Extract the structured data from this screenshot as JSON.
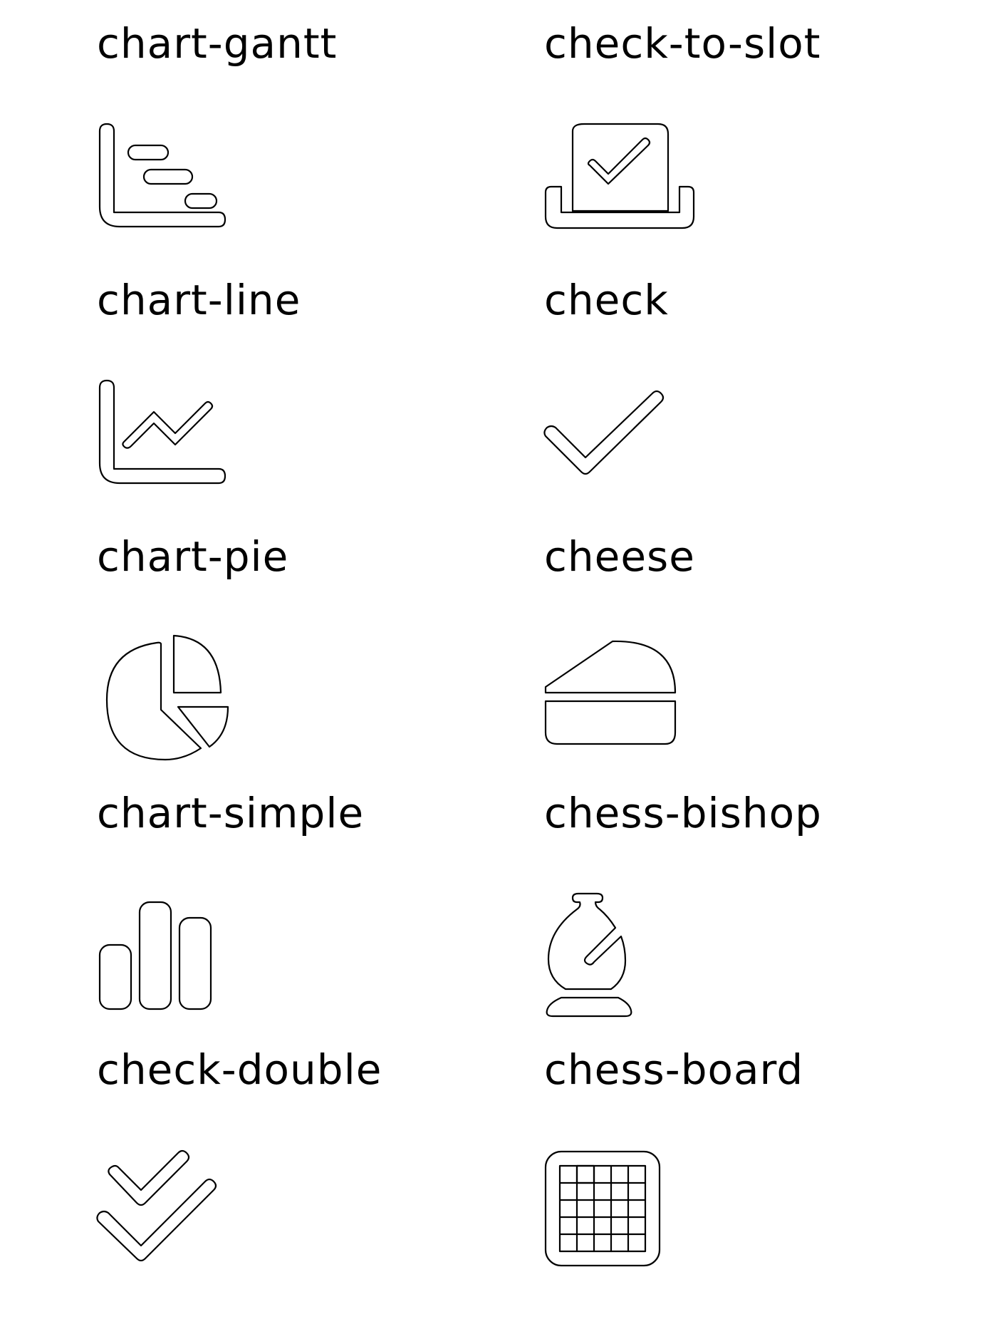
{
  "icons": [
    {
      "label": "chart-gantt",
      "icon": "chart-gantt-icon"
    },
    {
      "label": "check-to-slot",
      "icon": "check-to-slot-icon"
    },
    {
      "label": "chart-line",
      "icon": "chart-line-icon"
    },
    {
      "label": "check",
      "icon": "check-icon"
    },
    {
      "label": "chart-pie",
      "icon": "chart-pie-icon"
    },
    {
      "label": "cheese",
      "icon": "cheese-icon"
    },
    {
      "label": "chart-simple",
      "icon": "chart-simple-icon"
    },
    {
      "label": "chess-bishop",
      "icon": "chess-bishop-icon"
    },
    {
      "label": "check-double",
      "icon": "check-double-icon"
    },
    {
      "label": "chess-board",
      "icon": "chess-board-icon"
    }
  ]
}
